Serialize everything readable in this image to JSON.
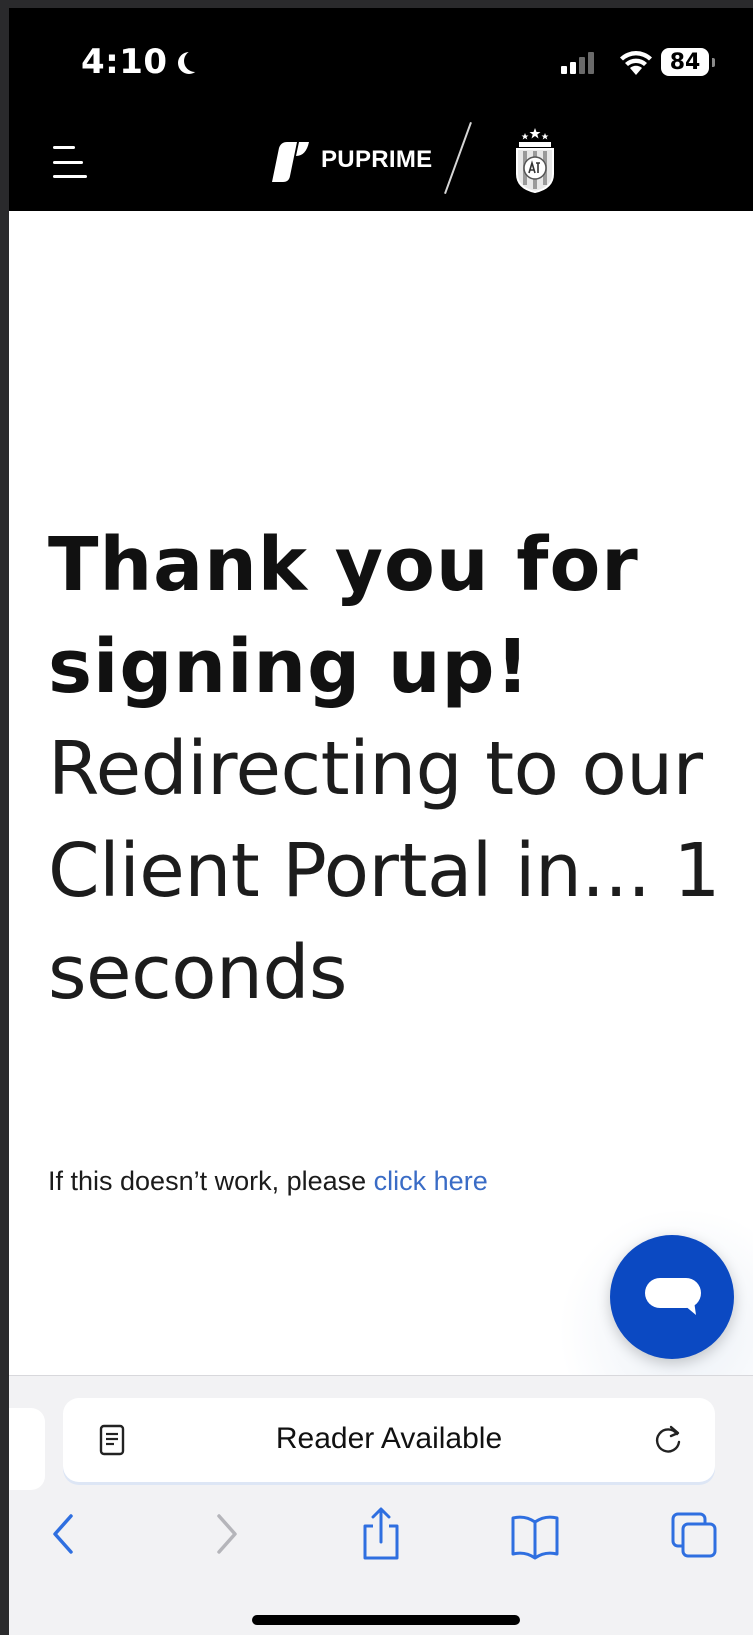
{
  "status_bar": {
    "time": "4:10",
    "battery": "84"
  },
  "header": {
    "brand_name": "PUPRIME"
  },
  "content": {
    "headline_bold_line1": "Thank you for",
    "headline_bold_line2": "signing up!",
    "redirect_line1": "Redirecting to our",
    "redirect_line2": "Client Portal in... 1",
    "redirect_line3": "seconds",
    "fallback_text": "If this doesn’t work, please ",
    "fallback_link": "click here"
  },
  "safari": {
    "address_text": "Reader Available"
  },
  "colors": {
    "link": "#3a6cc6",
    "chat_button": "#0b49c2",
    "safari_tint": "#2f6fe0"
  }
}
